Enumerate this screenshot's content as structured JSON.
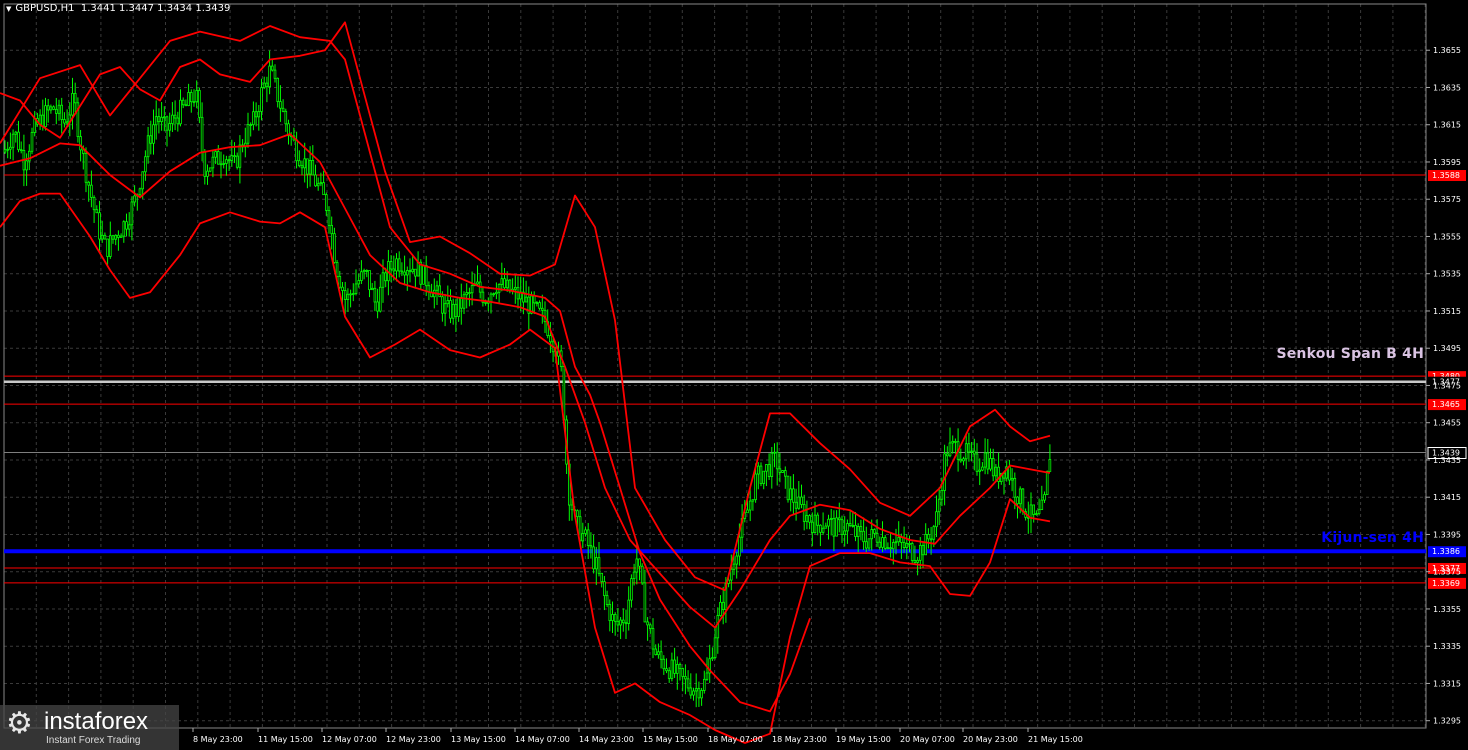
{
  "header": {
    "symbol": "GBPUSD,H1",
    "ohlc": "1.3441 1.3447 1.3434 1.3439"
  },
  "colors": {
    "background": "#000000",
    "grid": "#3a3a3a",
    "candle": "#00ff00",
    "indicator": "#ff0000",
    "kijun": "#0000ff",
    "senkou": "#c8c8c8",
    "label_bg_red": "#ff0000",
    "label_bg_blue": "#0000ff"
  },
  "annotations": {
    "senkou": "Senkou Span B 4H",
    "kijun": "Kijun-sen 4H"
  },
  "logo": {
    "brand": "instaforex",
    "tagline": "Instant Forex Trading",
    "icon": "gear-icon"
  },
  "chart_data": {
    "type": "candlestick",
    "ylim": [
      1.3289,
      1.3672
    ],
    "y_ticks": [
      "1.3655",
      "1.3635",
      "1.3615",
      "1.3595",
      "1.3575",
      "1.3555",
      "1.3535",
      "1.3515",
      "1.3495",
      "1.3475",
      "1.3455",
      "1.3435",
      "1.3415",
      "1.3395",
      "1.3375",
      "1.3355",
      "1.3335",
      "1.3315",
      "1.3295"
    ],
    "x_labels": [
      "8 May 23:00",
      "11 May 15:00",
      "12 May 07:00",
      "12 May 23:00",
      "13 May 15:00",
      "14 May 07:00",
      "14 May 23:00",
      "15 May 15:00",
      "18 May 07:00",
      "18 May 23:00",
      "19 May 15:00",
      "20 May 07:00",
      "20 May 23:00",
      "21 May 15:00"
    ],
    "horizontal_levels": [
      {
        "label": "1.3588",
        "value": 1.3588,
        "color": "#ff0000",
        "role": "level"
      },
      {
        "label": "1.3480",
        "value": 1.348,
        "color": "#ff0000",
        "role": "senkou-edge"
      },
      {
        "label": "1.3477",
        "value": 1.3477,
        "color": "#c8c8c8",
        "role": "senkou"
      },
      {
        "label": "1.3465",
        "value": 1.3465,
        "color": "#ff0000",
        "role": "level"
      },
      {
        "label": "1.3439",
        "value": 1.3439,
        "color": "#7f7f7f",
        "role": "current"
      },
      {
        "label": "1.3386",
        "value": 1.3386,
        "color": "#0000ff",
        "role": "kijun"
      },
      {
        "label": "1.3377",
        "value": 1.3377,
        "color": "#ff0000",
        "role": "level"
      },
      {
        "label": "1.3369",
        "value": 1.3369,
        "color": "#ff0000",
        "role": "level"
      }
    ],
    "price_path": [
      [
        0,
        1.3595
      ],
      [
        6,
        1.3603
      ],
      [
        14,
        1.3612
      ],
      [
        24,
        1.3596
      ],
      [
        34,
        1.3612
      ],
      [
        44,
        1.362
      ],
      [
        54,
        1.3624
      ],
      [
        64,
        1.3616
      ],
      [
        74,
        1.3628
      ],
      [
        82,
        1.36
      ],
      [
        90,
        1.358
      ],
      [
        98,
        1.356
      ],
      [
        106,
        1.3548
      ],
      [
        116,
        1.3556
      ],
      [
        126,
        1.3563
      ],
      [
        136,
        1.3576
      ],
      [
        146,
        1.36
      ],
      [
        156,
        1.362
      ],
      [
        166,
        1.3612
      ],
      [
        176,
        1.362
      ],
      [
        186,
        1.3625
      ],
      [
        196,
        1.3632
      ],
      [
        204,
        1.3592
      ],
      [
        214,
        1.3595
      ],
      [
        224,
        1.36
      ],
      [
        234,
        1.3592
      ],
      [
        244,
        1.3608
      ],
      [
        254,
        1.3617
      ],
      [
        262,
        1.3633
      ],
      [
        270,
        1.3644
      ],
      [
        278,
        1.363
      ],
      [
        288,
        1.3612
      ],
      [
        298,
        1.36
      ],
      [
        308,
        1.3592
      ],
      [
        318,
        1.3582
      ],
      [
        328,
        1.357
      ],
      [
        336,
        1.354
      ],
      [
        346,
        1.352
      ],
      [
        356,
        1.353
      ],
      [
        366,
        1.3535
      ],
      [
        376,
        1.3518
      ],
      [
        386,
        1.3535
      ],
      [
        396,
        1.3542
      ],
      [
        406,
        1.354
      ],
      [
        416,
        1.3538
      ],
      [
        426,
        1.3532
      ],
      [
        436,
        1.3524
      ],
      [
        446,
        1.3515
      ],
      [
        456,
        1.3515
      ],
      [
        466,
        1.3522
      ],
      [
        476,
        1.3528
      ],
      [
        486,
        1.3522
      ],
      [
        496,
        1.353
      ],
      [
        506,
        1.3527
      ],
      [
        516,
        1.3524
      ],
      [
        526,
        1.352
      ],
      [
        536,
        1.3515
      ],
      [
        546,
        1.3509
      ],
      [
        556,
        1.3495
      ],
      [
        562,
        1.348
      ],
      [
        568,
        1.342
      ],
      [
        576,
        1.34
      ],
      [
        586,
        1.3392
      ],
      [
        596,
        1.3378
      ],
      [
        606,
        1.3358
      ],
      [
        616,
        1.3345
      ],
      [
        626,
        1.3352
      ],
      [
        636,
        1.3385
      ],
      [
        646,
        1.335
      ],
      [
        656,
        1.333
      ],
      [
        666,
        1.3325
      ],
      [
        676,
        1.332
      ],
      [
        686,
        1.3315
      ],
      [
        696,
        1.3312
      ],
      [
        706,
        1.3316
      ],
      [
        716,
        1.3345
      ],
      [
        726,
        1.3365
      ],
      [
        736,
        1.3388
      ],
      [
        746,
        1.3405
      ],
      [
        756,
        1.3425
      ],
      [
        766,
        1.343
      ],
      [
        776,
        1.3435
      ],
      [
        786,
        1.342
      ],
      [
        796,
        1.3412
      ],
      [
        806,
        1.3405
      ],
      [
        816,
        1.34
      ],
      [
        826,
        1.3402
      ],
      [
        836,
        1.3398
      ],
      [
        846,
        1.34
      ],
      [
        856,
        1.3395
      ],
      [
        866,
        1.3392
      ],
      [
        876,
        1.3395
      ],
      [
        886,
        1.3392
      ],
      [
        896,
        1.339
      ],
      [
        906,
        1.3388
      ],
      [
        916,
        1.3385
      ],
      [
        926,
        1.339
      ],
      [
        936,
        1.3402
      ],
      [
        946,
        1.344
      ],
      [
        956,
        1.3442
      ],
      [
        966,
        1.3438
      ],
      [
        976,
        1.3432
      ],
      [
        986,
        1.3438
      ],
      [
        996,
        1.3426
      ],
      [
        1006,
        1.3432
      ],
      [
        1016,
        1.3418
      ],
      [
        1026,
        1.3408
      ],
      [
        1036,
        1.3402
      ],
      [
        1044,
        1.341
      ],
      [
        1050,
        1.3439
      ]
    ],
    "bands": {
      "upper": [
        [
          0,
          1.3632
        ],
        [
          20,
          1.3628
        ],
        [
          40,
          1.3615
        ],
        [
          60,
          1.3608
        ],
        [
          80,
          1.3625
        ],
        [
          100,
          1.3642
        ],
        [
          120,
          1.3646
        ],
        [
          140,
          1.3634
        ],
        [
          160,
          1.3628
        ],
        [
          180,
          1.3646
        ],
        [
          200,
          1.365
        ],
        [
          220,
          1.3642
        ],
        [
          250,
          1.3638
        ],
        [
          270,
          1.365
        ],
        [
          300,
          1.3652
        ],
        [
          325,
          1.3655
        ],
        [
          345,
          1.367
        ],
        [
          365,
          1.363
        ],
        [
          385,
          1.359
        ],
        [
          410,
          1.3552
        ],
        [
          440,
          1.3555
        ],
        [
          470,
          1.3546
        ],
        [
          500,
          1.3535
        ],
        [
          530,
          1.3534
        ],
        [
          555,
          1.354
        ],
        [
          575,
          1.3577
        ],
        [
          595,
          1.356
        ],
        [
          615,
          1.351
        ],
        [
          635,
          1.342
        ],
        [
          665,
          1.3392
        ],
        [
          695,
          1.3372
        ],
        [
          725,
          1.3365
        ],
        [
          750,
          1.342
        ],
        [
          770,
          1.346
        ],
        [
          790,
          1.346
        ],
        [
          820,
          1.3444
        ],
        [
          850,
          1.343
        ],
        [
          880,
          1.3412
        ],
        [
          910,
          1.3405
        ],
        [
          940,
          1.342
        ],
        [
          970,
          1.3453
        ],
        [
          995,
          1.3462
        ],
        [
          1010,
          1.3453
        ],
        [
          1030,
          1.3445
        ],
        [
          1050,
          1.3448
        ]
      ],
      "middle": [
        [
          0,
          1.3593
        ],
        [
          30,
          1.3597
        ],
        [
          60,
          1.3605
        ],
        [
          80,
          1.3604
        ],
        [
          110,
          1.3588
        ],
        [
          140,
          1.3576
        ],
        [
          170,
          1.359
        ],
        [
          200,
          1.36
        ],
        [
          230,
          1.3603
        ],
        [
          260,
          1.3604
        ],
        [
          290,
          1.361
        ],
        [
          320,
          1.3595
        ],
        [
          345,
          1.357
        ],
        [
          370,
          1.3545
        ],
        [
          400,
          1.353
        ],
        [
          430,
          1.3525
        ],
        [
          460,
          1.3522
        ],
        [
          490,
          1.352
        ],
        [
          520,
          1.3517
        ],
        [
          545,
          1.3512
        ],
        [
          565,
          1.3485
        ],
        [
          585,
          1.3455
        ],
        [
          605,
          1.342
        ],
        [
          630,
          1.3392
        ],
        [
          660,
          1.3374
        ],
        [
          690,
          1.3356
        ],
        [
          715,
          1.3345
        ],
        [
          740,
          1.3365
        ],
        [
          770,
          1.3392
        ],
        [
          790,
          1.3405
        ],
        [
          820,
          1.3411
        ],
        [
          850,
          1.3408
        ],
        [
          880,
          1.3398
        ],
        [
          910,
          1.3392
        ],
        [
          935,
          1.339
        ],
        [
          960,
          1.3405
        ],
        [
          990,
          1.342
        ],
        [
          1010,
          1.3432
        ],
        [
          1030,
          1.343
        ],
        [
          1050,
          1.3428
        ]
      ],
      "lower": [
        [
          0,
          1.356
        ],
        [
          20,
          1.3574
        ],
        [
          40,
          1.3578
        ],
        [
          60,
          1.3578
        ],
        [
          90,
          1.3555
        ],
        [
          110,
          1.3537
        ],
        [
          130,
          1.3522
        ],
        [
          150,
          1.3525
        ],
        [
          180,
          1.3545
        ],
        [
          200,
          1.3562
        ],
        [
          230,
          1.3568
        ],
        [
          260,
          1.3563
        ],
        [
          280,
          1.3562
        ],
        [
          300,
          1.3568
        ],
        [
          325,
          1.356
        ],
        [
          345,
          1.3512
        ],
        [
          370,
          1.349
        ],
        [
          395,
          1.3497
        ],
        [
          420,
          1.3505
        ],
        [
          450,
          1.3494
        ],
        [
          480,
          1.349
        ],
        [
          510,
          1.3497
        ],
        [
          530,
          1.3505
        ],
        [
          555,
          1.3495
        ],
        [
          575,
          1.3405
        ],
        [
          595,
          1.3345
        ],
        [
          615,
          1.331
        ],
        [
          635,
          1.3315
        ],
        [
          660,
          1.3305
        ],
        [
          690,
          1.3298
        ],
        [
          715,
          1.329
        ],
        [
          745,
          1.3283
        ],
        [
          770,
          1.3288
        ],
        [
          790,
          1.334
        ],
        [
          810,
          1.3378
        ],
        [
          840,
          1.3385
        ],
        [
          870,
          1.3385
        ],
        [
          900,
          1.338
        ],
        [
          930,
          1.3378
        ],
        [
          950,
          1.3363
        ],
        [
          970,
          1.3362
        ],
        [
          990,
          1.338
        ],
        [
          1010,
          1.3414
        ],
        [
          1030,
          1.3404
        ],
        [
          1050,
          1.3402
        ]
      ],
      "fast": [
        [
          0,
          1.3605
        ],
        [
          40,
          1.364
        ],
        [
          80,
          1.3647
        ],
        [
          110,
          1.362
        ],
        [
          140,
          1.364
        ],
        [
          170,
          1.366
        ],
        [
          200,
          1.3665
        ],
        [
          240,
          1.366
        ],
        [
          270,
          1.3668
        ],
        [
          300,
          1.3662
        ],
        [
          330,
          1.366
        ],
        [
          345,
          1.365
        ],
        [
          365,
          1.361
        ],
        [
          390,
          1.356
        ],
        [
          420,
          1.354
        ],
        [
          450,
          1.3535
        ],
        [
          480,
          1.3528
        ],
        [
          510,
          1.3526
        ],
        [
          545,
          1.3522
        ],
        [
          560,
          1.3515
        ],
        [
          575,
          1.3485
        ],
        [
          590,
          1.347
        ],
        [
          600,
          1.3455
        ],
        [
          620,
          1.342
        ],
        [
          640,
          1.3385
        ],
        [
          660,
          1.336
        ],
        [
          690,
          1.3335
        ],
        [
          710,
          1.3322
        ],
        [
          740,
          1.3305
        ],
        [
          770,
          1.33
        ],
        [
          790,
          1.332
        ],
        [
          810,
          1.335
        ]
      ]
    }
  }
}
